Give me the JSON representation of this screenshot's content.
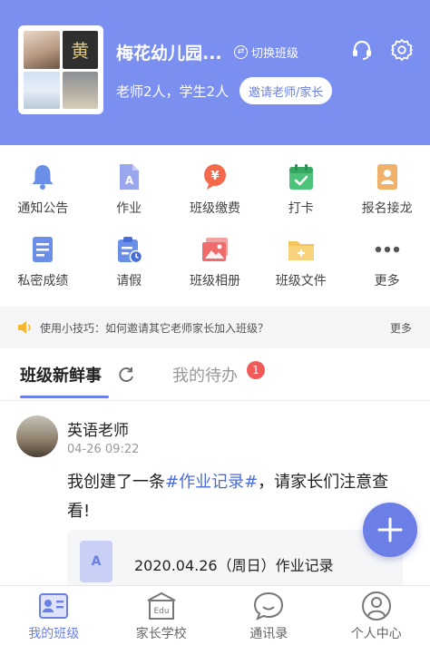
{
  "header": {
    "class_name": "梅花幼儿园...",
    "switch_label": "切换班级",
    "class_stats": "老师2人，学生2人",
    "invite_label": "邀请老师/家长",
    "avatar_glyph": "黄"
  },
  "grid": {
    "items": [
      {
        "label": "通知公告",
        "icon": "bell-icon"
      },
      {
        "label": "作业",
        "icon": "homework-icon"
      },
      {
        "label": "班级缴费",
        "icon": "payment-icon"
      },
      {
        "label": "打卡",
        "icon": "checkin-icon"
      },
      {
        "label": "报名接龙",
        "icon": "signup-icon"
      },
      {
        "label": "私密成绩",
        "icon": "grades-icon"
      },
      {
        "label": "请假",
        "icon": "leave-icon"
      },
      {
        "label": "班级相册",
        "icon": "album-icon"
      },
      {
        "label": "班级文件",
        "icon": "files-icon"
      },
      {
        "label": "更多",
        "icon": "more-icon"
      }
    ]
  },
  "tip": {
    "text": "使用小技巧：如何邀请其它老师家长加入班级？",
    "more": "更多"
  },
  "tabs": {
    "active": "班级新鲜事",
    "todo": "我的待办",
    "todo_badge": "1"
  },
  "post": {
    "author": "英语老师",
    "time": "04-26 09:22",
    "text_before": "我创建了一条",
    "hashtag": "#作业记录#",
    "text_after": "，请家长们注意查看!",
    "attach_icon_letter": "A",
    "attach_title": "2020.04.26（周日）作业记录"
  },
  "bottom_nav": [
    {
      "label": "我的班级",
      "active": true
    },
    {
      "label": "家长学校",
      "active": false
    },
    {
      "label": "通讯录",
      "active": false
    },
    {
      "label": "个人中心",
      "active": false
    }
  ],
  "colors": {
    "accent": "#6b7fe6",
    "header_bg": "#7a8ff0",
    "badge": "#f25a5a"
  }
}
